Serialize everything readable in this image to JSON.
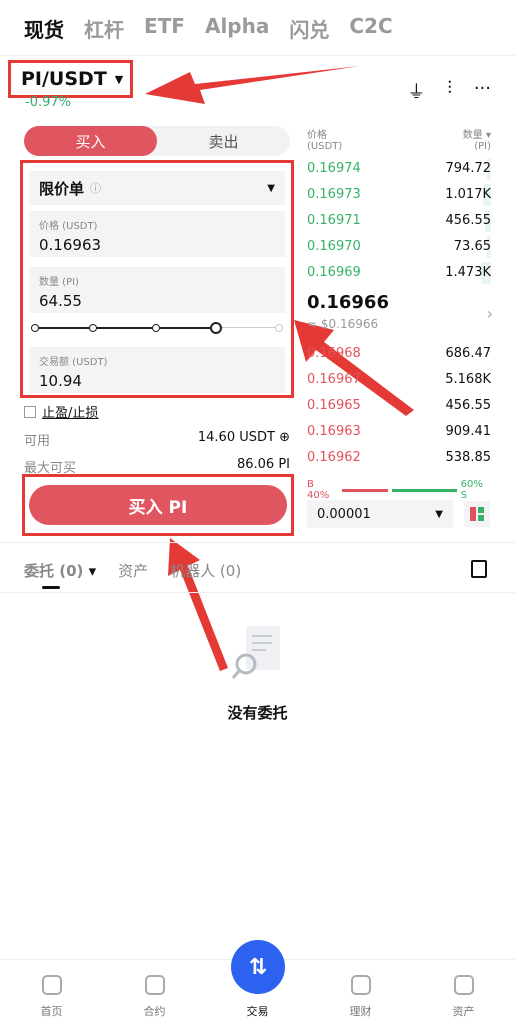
{
  "top_tabs": [
    "现货",
    "杠杆",
    "ETF",
    "Alpha",
    "闪兑",
    "C2C"
  ],
  "pair": {
    "name": "PI/USDT",
    "change": "-0.97%"
  },
  "side_toggle": {
    "buy": "买入",
    "sell": "卖出"
  },
  "order_form": {
    "order_type": "限价单",
    "price_label": "价格 (USDT)",
    "price_value": "0.16963",
    "amount_label": "数量 (PI)",
    "amount_value": "64.55",
    "total_label": "交易额 (USDT)",
    "total_value": "10.94",
    "slider_level": 0.75,
    "tpsl_label": "止盈/止损",
    "available_label": "可用",
    "available_value": "14.60 USDT",
    "max_buy_label": "最大可买",
    "max_buy_value": "86.06 PI",
    "buy_button": "买入 PI"
  },
  "order_book": {
    "price_header": "价格\n(USDT)",
    "price_header_1": "价格",
    "price_header_2": "(USDT)",
    "qty_header_1": "数量 ▾",
    "qty_header_2": "(PI)",
    "asks": [
      {
        "price": "0.16974",
        "qty": "794.72"
      },
      {
        "price": "0.16973",
        "qty": "1.017K"
      },
      {
        "price": "0.16971",
        "qty": "456.55"
      },
      {
        "price": "0.16970",
        "qty": "73.65"
      },
      {
        "price": "0.16969",
        "qty": "1.473K"
      }
    ],
    "mid_price": "0.16966",
    "mid_sub": "≈ $0.16966",
    "bids": [
      {
        "price": "0.16968",
        "qty": "686.47"
      },
      {
        "price": "0.16967",
        "qty": "5.168K"
      },
      {
        "price": "0.16965",
        "qty": "456.55"
      },
      {
        "price": "0.16963",
        "qty": "909.41"
      },
      {
        "price": "0.16962",
        "qty": "538.85"
      }
    ],
    "buy_ratio": "B 40%",
    "sell_ratio": "60% S",
    "precision": "0.00001"
  },
  "orders": {
    "tab_orders": "委托 (0)",
    "tab_assets": "资产",
    "tab_bots": "机器人 (0)",
    "empty_text": "没有委托"
  },
  "bottom_nav": [
    "首页",
    "合约",
    "交易",
    "理财",
    "资产"
  ],
  "colors": {
    "buy": "#df5660",
    "ask_green": "#35b267",
    "bid_red": "#e2515d",
    "annotation_red": "#e53935",
    "fab_blue": "#2d62f0"
  }
}
